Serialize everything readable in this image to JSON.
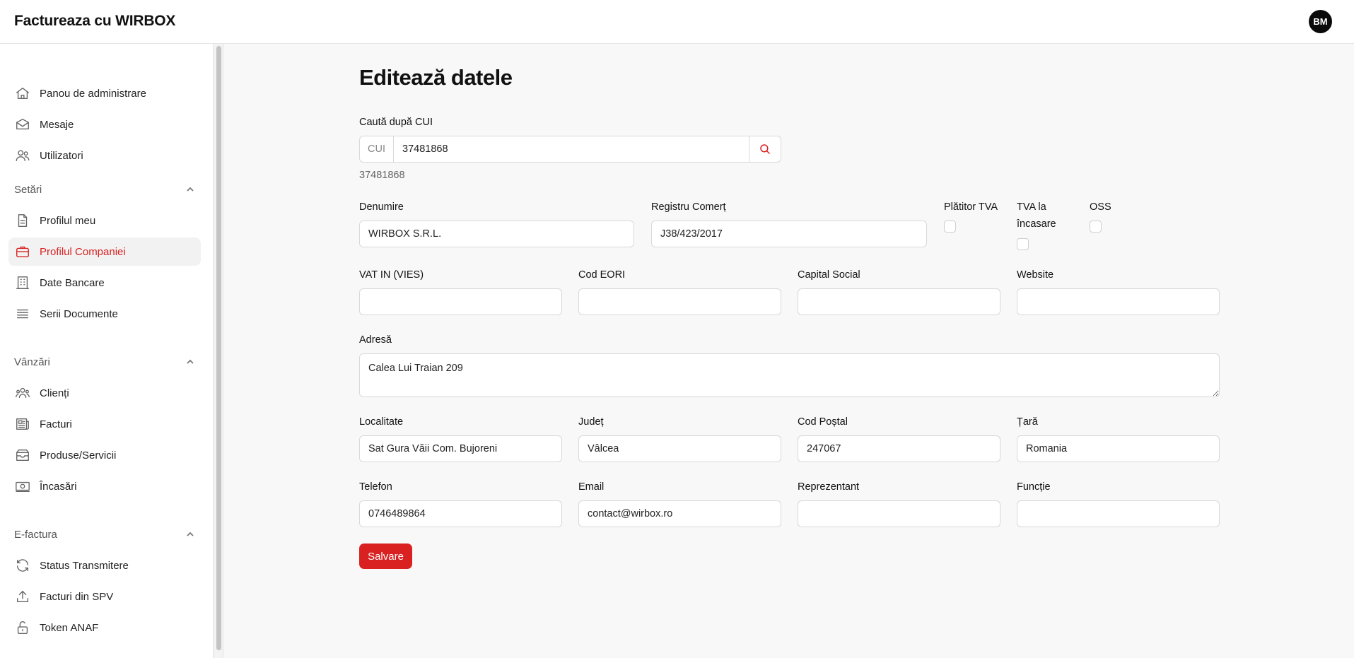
{
  "header": {
    "title": "Factureaza cu WIRBOX",
    "avatar_initials": "BM"
  },
  "sidebar": {
    "main": [
      {
        "label": "Panou de administrare",
        "icon": "home-icon"
      },
      {
        "label": "Mesaje",
        "icon": "mail-icon"
      },
      {
        "label": "Utilizatori",
        "icon": "users-icon"
      }
    ],
    "sections": [
      {
        "title": "Setări",
        "items": [
          {
            "label": "Profilul meu",
            "icon": "document-icon"
          },
          {
            "label": "Profilul Companiei",
            "icon": "briefcase-icon",
            "active": true
          },
          {
            "label": "Date Bancare",
            "icon": "building-icon"
          },
          {
            "label": "Serii Documente",
            "icon": "list-icon"
          }
        ]
      },
      {
        "title": "Vânzări",
        "items": [
          {
            "label": "Clienți",
            "icon": "clients-icon"
          },
          {
            "label": "Facturi",
            "icon": "newspaper-icon"
          },
          {
            "label": "Produse/Servicii",
            "icon": "box-icon"
          },
          {
            "label": "Încasări",
            "icon": "cash-icon"
          }
        ]
      },
      {
        "title": "E-factura",
        "items": [
          {
            "label": "Status Transmitere",
            "icon": "refresh-icon"
          },
          {
            "label": "Facturi din SPV",
            "icon": "upload-icon"
          },
          {
            "label": "Token ANAF",
            "icon": "lock-open-icon"
          }
        ]
      }
    ]
  },
  "main": {
    "title": "Editează datele",
    "cui_search": {
      "label": "Caută după CUI",
      "prefix": "CUI",
      "value": "37481868",
      "hint": "37481868"
    },
    "fields": {
      "denumire": {
        "label": "Denumire",
        "value": "WIRBOX S.R.L."
      },
      "registru": {
        "label": "Registru Comerț",
        "value": "J38/423/2017"
      },
      "platitor_tva": {
        "label": "Plătitor TVA"
      },
      "tva_incasare": {
        "label_line1": "TVA la",
        "label_line2": "încasare"
      },
      "oss": {
        "label": "OSS"
      },
      "vat_in": {
        "label": "VAT IN (VIES)",
        "value": ""
      },
      "cod_eori": {
        "label": "Cod EORI",
        "value": ""
      },
      "capital": {
        "label": "Capital Social",
        "value": ""
      },
      "website": {
        "label": "Website",
        "value": ""
      },
      "adresa": {
        "label": "Adresă",
        "value": "Calea Lui Traian 209"
      },
      "localitate": {
        "label": "Localitate",
        "value": "Sat Gura Văii Com. Bujoreni"
      },
      "judet": {
        "label": "Județ",
        "value": "Vâlcea"
      },
      "cod_postal": {
        "label": "Cod Poștal",
        "value": "247067"
      },
      "tara": {
        "label": "Țară",
        "value": "Romania"
      },
      "telefon": {
        "label": "Telefon",
        "value": "0746489864"
      },
      "email": {
        "label": "Email",
        "value": "contact@wirbox.ro"
      },
      "reprezentant": {
        "label": "Reprezentant",
        "value": ""
      },
      "functie": {
        "label": "Funcție",
        "value": ""
      }
    },
    "save_label": "Salvare"
  },
  "colors": {
    "accent": "#d92121",
    "active_bg": "#f2f2f2",
    "page_bg": "#f8f8f8"
  }
}
